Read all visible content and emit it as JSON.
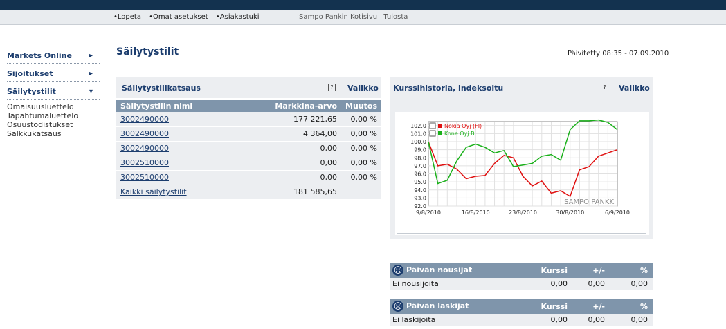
{
  "topnav": {
    "links": [
      "•Lopeta",
      "•Omat asetukset",
      "•Asiakastuki"
    ],
    "external": [
      "Sampo Pankin Kotisivu",
      "Tulosta"
    ]
  },
  "sidebar": {
    "items": [
      {
        "label": "Markets Online",
        "arrow": "▸"
      },
      {
        "label": "Sijoitukset",
        "arrow": "▸"
      },
      {
        "label": "Säilytystilit",
        "arrow": "▾"
      }
    ],
    "subitems": [
      "Omaisuusluettelo",
      "Tapahtumaluettelo",
      "Osuustodistukset",
      "Salkkukatsaus"
    ]
  },
  "page": {
    "title": "Säilytystilit",
    "updated": "Päivitetty 08:35 - 07.09.2010"
  },
  "accounts": {
    "title": "Säilytystilikatsaus",
    "help": "?",
    "menu": "Valikko",
    "headers": [
      "Säilytystilin nimi",
      "Markkina-arvo",
      "Muutos"
    ],
    "rows": [
      {
        "name": "3002490000",
        "value": "177 221,65",
        "change": "0,00 %"
      },
      {
        "name": "3002490000",
        "value": "4 364,00",
        "change": "0,00 %"
      },
      {
        "name": "3002490000",
        "value": "0,00",
        "change": "0,00 %"
      },
      {
        "name": "3002510000",
        "value": "0,00",
        "change": "0,00 %"
      },
      {
        "name": "3002510000",
        "value": "0,00",
        "change": "0,00 %"
      }
    ],
    "total": {
      "name": "Kaikki säilytystilit",
      "value": "181 585,65"
    }
  },
  "history": {
    "title": "Kurssihistoria, indeksoitu",
    "help": "?",
    "menu": "Valikko"
  },
  "chart_data": {
    "type": "line",
    "title": "",
    "xlabel": "",
    "ylabel": "",
    "ylim": [
      92.0,
      102.5
    ],
    "yticks": [
      "102.0",
      "101.0",
      "100.0",
      "99.0",
      "98.0",
      "97.0",
      "96.0",
      "95.0",
      "94.0",
      "93.0",
      "92.0"
    ],
    "xticks": [
      "9/8/2010",
      "16/8/2010",
      "23/8/2010",
      "30/8/2010",
      "6/9/2010"
    ],
    "x": [
      0,
      1,
      2,
      3,
      4,
      5,
      6,
      7,
      8,
      9,
      10,
      11,
      12,
      13,
      14,
      15,
      16,
      17,
      18,
      19,
      20
    ],
    "series": [
      {
        "name": "Nokia Oyj (FI)",
        "color": "#e01010",
        "values": [
          100.0,
          97.0,
          97.2,
          96.6,
          95.4,
          95.7,
          95.8,
          97.3,
          98.3,
          98.0,
          95.7,
          94.5,
          95.1,
          93.6,
          93.9,
          93.2,
          96.5,
          96.9,
          98.2,
          98.6,
          99.0
        ]
      },
      {
        "name": "Kone Oyj B",
        "color": "#19b019",
        "values": [
          100.0,
          94.8,
          95.2,
          97.6,
          99.3,
          99.7,
          99.3,
          98.6,
          98.9,
          96.9,
          97.1,
          97.3,
          98.2,
          98.4,
          97.7,
          101.5,
          102.6,
          102.6,
          102.7,
          102.4,
          101.5
        ]
      }
    ],
    "grid": true,
    "legend": "top-left",
    "watermark": "SAMPO PANKKI"
  },
  "risers": {
    "title": "Päivän nousijat",
    "headers": [
      "Kurssi",
      "+/-",
      "%"
    ],
    "row": [
      "Ei nousijoita",
      "0,00",
      "0,00",
      "0,00"
    ]
  },
  "fallers": {
    "title": "Päivän laskijat",
    "headers": [
      "Kurssi",
      "+/-",
      "%"
    ],
    "row": [
      "Ei laskijoita",
      "0,00",
      "0,00",
      "0,00"
    ]
  },
  "colors": {
    "brand": "#13324f",
    "accent": "#1c3d6e",
    "header": "#7f95ab",
    "panel": "#eceef1"
  }
}
